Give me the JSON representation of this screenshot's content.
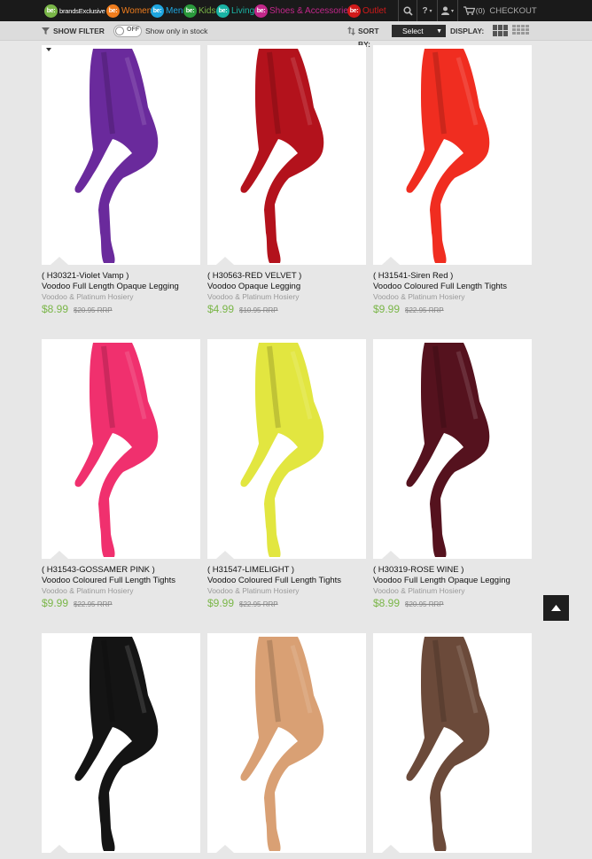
{
  "nav": {
    "brand_badge": "be:",
    "brand_name": "brandsExclusive",
    "items": [
      {
        "badge": "be:",
        "label": "Women",
        "color": "#f07d1d"
      },
      {
        "badge": "be:",
        "label": "Men",
        "color": "#1ea6e0"
      },
      {
        "badge": "be:",
        "label": "Kids",
        "color": "#7ab648"
      },
      {
        "badge": "be:",
        "label": "Living",
        "color": "#19b3a4"
      },
      {
        "badge": "be:",
        "label": "Shoes & Accessories",
        "color": "#c2278a"
      },
      {
        "badge": "be:",
        "label": "Outlet",
        "color": "#d11a1a"
      }
    ],
    "help": "?",
    "cart_count": "(0)",
    "checkout": "CHECKOUT"
  },
  "filterbar": {
    "show_filter": "SHOW FILTER",
    "toggle_state": "OFF",
    "stock_label": "Show only in stock",
    "sort_label": "SORT",
    "sort_by": "BY:",
    "select_value": "Select",
    "display_label": "DISPLAY:"
  },
  "products": [
    {
      "code": "( H30321-Violet Vamp )",
      "name": "Voodoo Full Length Opaque Legging",
      "brand": "Voodoo & Platinum Hosiery",
      "price": "$8.99",
      "rrp": "$20.95 RRP",
      "color": "#6a2a9c"
    },
    {
      "code": "( H30563-RED VELVET )",
      "name": "Voodoo Opaque Legging",
      "brand": "Voodoo & Platinum Hosiery",
      "price": "$4.99",
      "rrp": "$10.95 RRP",
      "color": "#b3121c"
    },
    {
      "code": "( H31541-Siren Red )",
      "name": "Voodoo Coloured Full Length Tights",
      "brand": "Voodoo & Platinum Hosiery",
      "price": "$9.99",
      "rrp": "$22.95 RRP",
      "color": "#f02d20"
    },
    {
      "code": "( H31543-GOSSAMER PINK )",
      "name": "Voodoo Coloured Full Length Tights",
      "brand": "Voodoo & Platinum Hosiery",
      "price": "$9.99",
      "rrp": "$22.95 RRP",
      "color": "#f0306e"
    },
    {
      "code": "( H31547-LIMELIGHT )",
      "name": "Voodoo Coloured Full Length Tights",
      "brand": "Voodoo & Platinum Hosiery",
      "price": "$9.99",
      "rrp": "$22.95 RRP",
      "color": "#e2e640"
    },
    {
      "code": "( H30319-ROSE WINE )",
      "name": "Voodoo Full Length Opaque Legging",
      "brand": "Voodoo & Platinum Hosiery",
      "price": "$8.99",
      "rrp": "$20.95 RRP",
      "color": "#55121e"
    },
    {
      "code": "",
      "name": "",
      "brand": "",
      "price": "",
      "rrp": "",
      "color": "#141414"
    },
    {
      "code": "",
      "name": "",
      "brand": "",
      "price": "",
      "rrp": "",
      "color": "#d9a074"
    },
    {
      "code": "",
      "name": "",
      "brand": "",
      "price": "",
      "rrp": "",
      "color": "#6b4a3a"
    }
  ]
}
